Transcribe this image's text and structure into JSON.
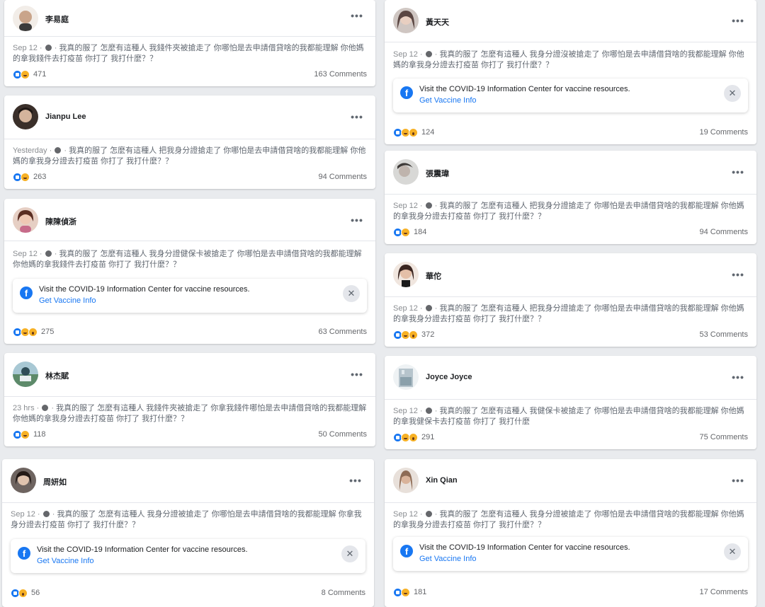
{
  "posts": [
    {
      "name": "李易庭",
      "meta": "Sep 12",
      "text": "我真的服了 怎麼有這種人 我錢件夾被搶走了 你哪怕是去申請借貸啥的我都能理解 你他媽的拿我錢件去打疫苗 你打了 我打什麼？？",
      "reactions_count": "471",
      "comments": "163 Comments",
      "reactions": [
        "like",
        "haha"
      ],
      "covid": false,
      "avatar_color": "#c9a48a"
    },
    {
      "name": "Jianpu Lee",
      "meta": "Yesterday",
      "text": "我真的服了 怎麼有這種人 把我身分證搶走了 你哪怕是去申請借貸啥的我都能理解 你他媽的拿我身分證去打疫苗 你打了 我打什麼？？",
      "reactions_count": "263",
      "comments": "94 Comments",
      "reactions": [
        "like",
        "haha"
      ],
      "covid": false,
      "avatar_color": "#3a2f2a"
    },
    {
      "name": "陳陳偵浙",
      "meta": "Sep 12",
      "text": "我真的服了 怎麼有這種人 我身分證健保卡被搶走了 你哪怕是去申請借貸啥的我都能理解 你他媽的拿我錢件去打疫苗 你打了 我打什麼？？",
      "reactions_count": "275",
      "comments": "63 Comments",
      "reactions": [
        "like",
        "haha",
        "wow"
      ],
      "covid": true,
      "avatar_color": "#8a4a3a"
    },
    {
      "name": "林杰賦",
      "meta": "23 hrs",
      "text": "我真的服了 怎麼有這種人 我錢件夾被搶走了 你拿我錢件哪怕是去申請借貸啥的我都能理解 你他媽的拿我身分證去打疫苗 你打了 我打什麼？？",
      "reactions_count": "118",
      "comments": "50 Comments",
      "reactions": [
        "like",
        "haha"
      ],
      "covid": false,
      "avatar_color": "#7fa8b0"
    },
    {
      "name": "周妍如",
      "meta": "Sep 12",
      "text": "我真的服了 怎麼有這種人 我身分證被搶走了 你哪怕是去申請借貸啥的我都能理解 你拿我身分證去打疫苗 你打了 我打什麼？？",
      "reactions_count": "56",
      "comments": "8 Comments",
      "reactions": [
        "like",
        "wow"
      ],
      "covid": true,
      "avatar_color": "#4a3b35"
    },
    {
      "name": "黃天天",
      "meta": "Sep 12",
      "text": "我真的服了 怎麼有這種人 我身分證沒被搶走了 你哪怕是去申請借貸啥的我都能理解 你他媽的拿我身分證去打疫苗 你打了 我打什麼？？",
      "reactions_count": "124",
      "comments": "19 Comments",
      "reactions": [
        "like",
        "haha",
        "wow"
      ],
      "covid": true,
      "avatar_color": "#5a4642"
    },
    {
      "name": "張震瑋",
      "meta": "Sep 12",
      "text": "我真的服了 怎麼有這種人 把我身分證搶走了 你哪怕是去申請借貸啥的我都能理解 你他媽的拿我身分證去打疫苗 你打了 我打什麼？？",
      "reactions_count": "184",
      "comments": "94 Comments",
      "reactions": [
        "like",
        "haha"
      ],
      "covid": false,
      "avatar_color": "#9ba0a4"
    },
    {
      "name": "華佗",
      "meta": "Sep 12",
      "text": "我真的服了 怎麼有這種人 把我身分證搶走了 你哪怕是去申請借貸啥的我都能理解 你他媽的拿我身分證去打疫苗 你打了 我打什麼？？",
      "reactions_count": "372",
      "comments": "53 Comments",
      "reactions": [
        "like",
        "haha",
        "wow"
      ],
      "covid": false,
      "avatar_color": "#c59a86"
    },
    {
      "name": "Joyce Joyce",
      "meta": "Sep 12",
      "text": "我真的服了 怎麼有這種人 我健保卡被搶走了 你哪怕是去申請借貸啥的我都能理解 你他媽的拿我健保卡去打疫苗 你打了 我打什麼",
      "reactions_count": "291",
      "comments": "75 Comments",
      "reactions": [
        "like",
        "haha",
        "wow"
      ],
      "covid": false,
      "avatar_color": "#b6c4cc"
    },
    {
      "name": "Xin Qian",
      "meta": "Sep 12",
      "text": "我真的服了 怎麼有這種人 我身分證被搶走了 你哪怕是去申請借貸啥的我都能理解 你他媽的拿我身分證去打疫苗 你打了 我打什麼？？",
      "reactions_count": "181",
      "comments": "17 Comments",
      "reactions": [
        "like",
        "haha"
      ],
      "covid": true,
      "avatar_color": "#8d6b55"
    }
  ],
  "covid_banner": {
    "text": "Visit the COVID-19 Information Center for vaccine resources.",
    "link": "Get Vaccine Info",
    "fb_letter": "f",
    "close": "✕"
  },
  "more_icon": "•••",
  "separator": " · "
}
